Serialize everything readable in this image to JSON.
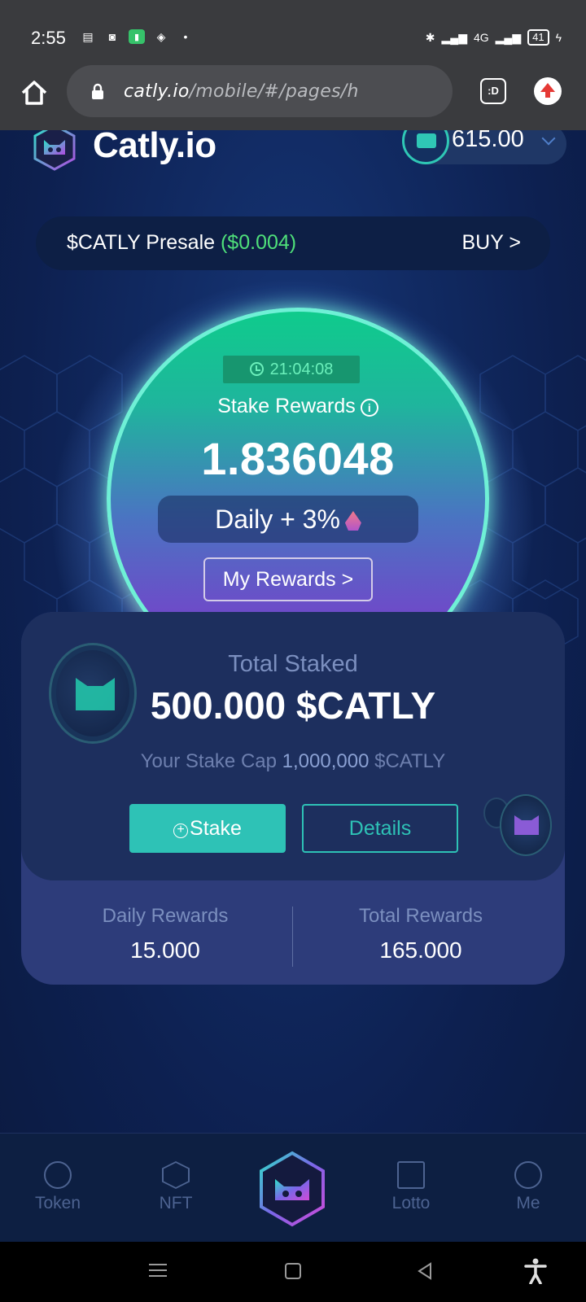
{
  "status_bar": {
    "time": "2:55",
    "battery": "41",
    "network": "4G"
  },
  "browser": {
    "url_host": "catly.io",
    "url_path": "/mobile/#/pages/h",
    "tabs_label": ":D"
  },
  "header": {
    "brand": "Catly.io",
    "wallet_balance": "615.00"
  },
  "presale": {
    "label": "$CATLY Presale",
    "price": "($0.004)",
    "cta": "BUY >"
  },
  "orb": {
    "timer": "21:04:08",
    "title": "Stake Rewards",
    "value": "1.836048",
    "daily": "Daily + 3%",
    "my_rewards": "My Rewards  >"
  },
  "staking": {
    "total_staked_label": "Total Staked",
    "total_staked_value": "500.000 $CATLY",
    "cap_label": "Your Stake Cap",
    "cap_value": "1,000,000",
    "cap_unit": "$CATLY",
    "stake_button": "Stake",
    "details_button": "Details",
    "daily_rewards_label": "Daily Rewards",
    "daily_rewards_value": "15.000",
    "total_rewards_label": "Total Rewards",
    "total_rewards_value": "165.000"
  },
  "bottom_nav": {
    "items": [
      {
        "label": "Token",
        "icon": "token-icon"
      },
      {
        "label": "NFT",
        "icon": "nft-icon"
      },
      {
        "label": "",
        "icon": "catly-hex-icon"
      },
      {
        "label": "Lotto",
        "icon": "lotto-icon"
      },
      {
        "label": "Me",
        "icon": "profile-icon"
      }
    ]
  },
  "colors": {
    "accent_teal": "#2ec2b6",
    "presale_green": "#4fe07a",
    "background_navy": "#0d1f42"
  }
}
